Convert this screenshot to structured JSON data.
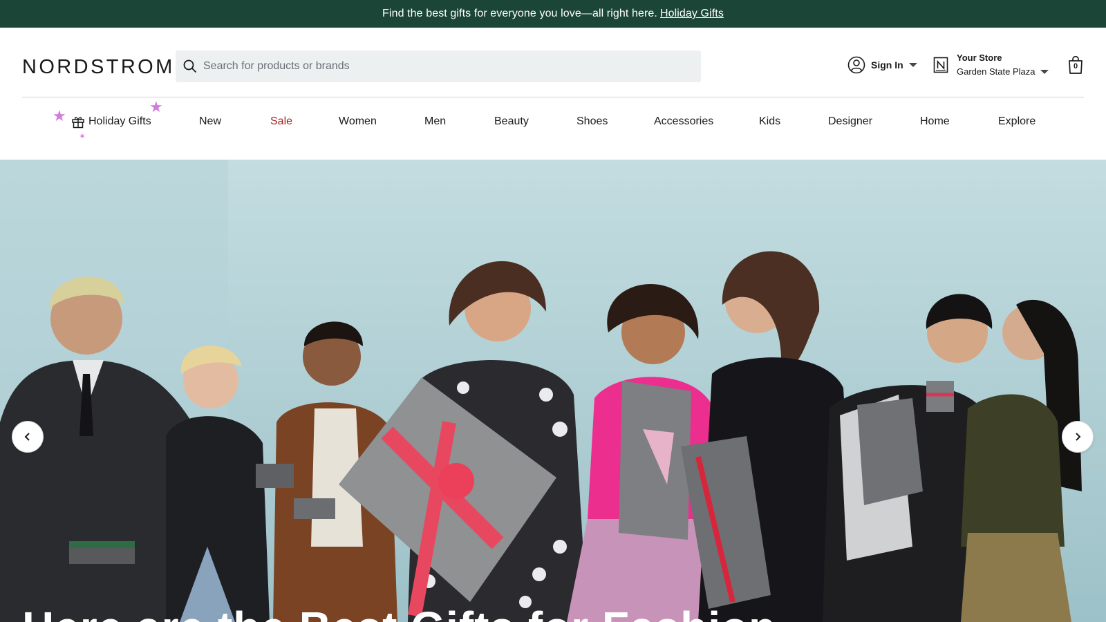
{
  "promo": {
    "text": "Find the best gifts for everyone you love—all right here.",
    "link": "Holiday Gifts"
  },
  "header": {
    "logo": "NORDSTROM",
    "search_placeholder": "Search for products or brands",
    "sign_in": "Sign In",
    "store": {
      "title": "Your Store",
      "name": "Garden State Plaza"
    },
    "bag_count": "0"
  },
  "nav": {
    "items": [
      {
        "label": "Holiday Gifts"
      },
      {
        "label": "New"
      },
      {
        "label": "Sale"
      },
      {
        "label": "Women"
      },
      {
        "label": "Men"
      },
      {
        "label": "Beauty"
      },
      {
        "label": "Shoes"
      },
      {
        "label": "Accessories"
      },
      {
        "label": "Kids"
      },
      {
        "label": "Designer"
      },
      {
        "label": "Home"
      },
      {
        "label": "Explore"
      }
    ]
  },
  "hero": {
    "headline": "Here are the Best Gifts for Fashion",
    "prev_icon": "chevron-left-icon",
    "next_icon": "chevron-right-icon"
  },
  "colors": {
    "promo_bg": "#1b4536",
    "sale": "#a3221f",
    "sparkle": "#d27bdc",
    "search_bg": "#ecf0f1"
  }
}
